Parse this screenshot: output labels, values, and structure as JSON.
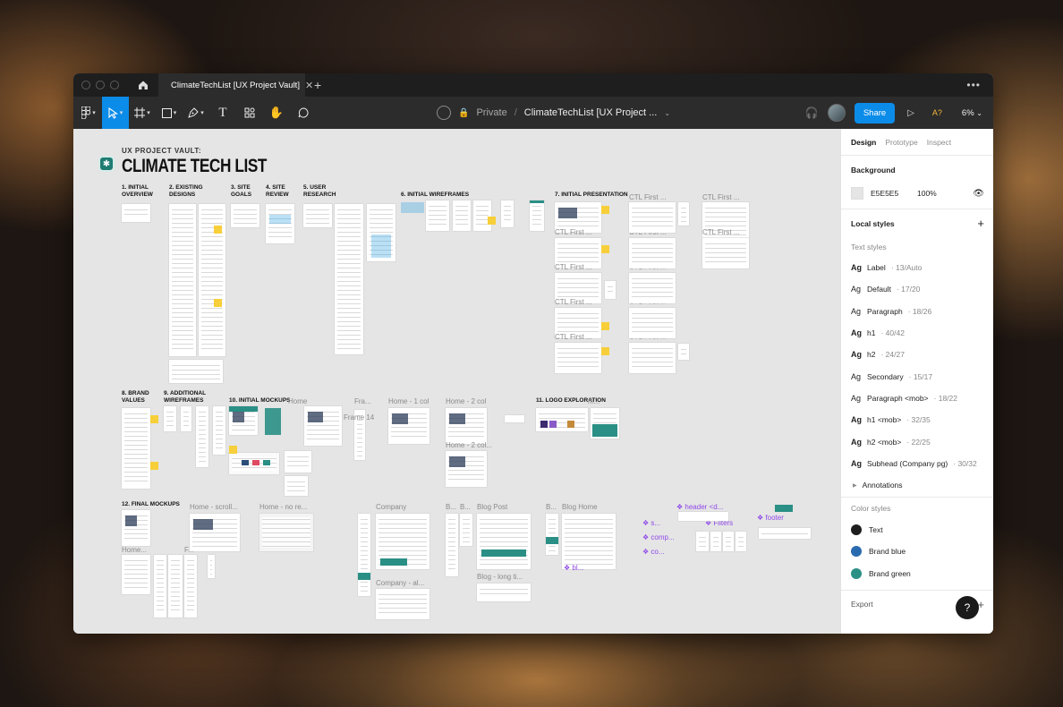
{
  "tab": {
    "title": "ClimateTechList [UX Project Vault]"
  },
  "toolbar": {
    "visibility": "Private",
    "slash": "/",
    "file_name": "ClimateTechList [UX Project ...",
    "share_label": "Share",
    "a11y_label": "A?",
    "zoom": "6%"
  },
  "canvas": {
    "kicker": "UX PROJECT VAULT:",
    "title": "CLIMATE TECH LIST",
    "sections": [
      "1. INITIAL\nOVERVIEW",
      "2. EXISTING\nDESIGNS",
      "3. SITE\nGOALS",
      "4. SITE\nREVIEW",
      "5. USER\nRESEARCH",
      "6. INITIAL WIREFRAMES",
      "7. INITIAL PRESENTATION",
      "8. BRAND\nVALUES",
      "9. ADDITIONAL\nWIREFRAMES",
      "10. INITIAL MOCKUPS",
      "11. LOGO EXPLORATION",
      "12. FINAL MOCKUPS"
    ],
    "frame_labels": {
      "ctl": "CTL First ...",
      "home": "Home",
      "fra": "Fra...",
      "frame14": "Frame 14",
      "home_1col": "Home - 1 col",
      "home_2col": "Home - 2 col",
      "home_2col_short": "Home - 2 col...",
      "home_scroll": "Home - scroll...",
      "home_nore": "Home - no re...",
      "company": "Company",
      "company_al": "Company - al...",
      "blog_post": "Blog Post",
      "blog_long": "Blog - long ti...",
      "blog_home": "Blog Home",
      "b_short": "B...",
      "home_short": "Home...",
      "f_short": "F...",
      "m_short": "m..."
    },
    "components": {
      "header": "header <d...",
      "filters": "Filters",
      "footer": "footer",
      "s": "s...",
      "comp": "comp...",
      "co": "co...",
      "bl": "bl..."
    }
  },
  "panel": {
    "tabs": [
      "Design",
      "Prototype",
      "Inspect"
    ],
    "background_title": "Background",
    "background_hex": "E5E5E5",
    "background_opacity": "100%",
    "local_styles_title": "Local styles",
    "text_styles_title": "Text styles",
    "text_styles": [
      {
        "name": "Label",
        "meta": " · 13/Auto",
        "bold": true
      },
      {
        "name": "Default",
        "meta": " · 17/20",
        "bold": false
      },
      {
        "name": "Paragraph",
        "meta": " · 18/26",
        "bold": false
      },
      {
        "name": "h1",
        "meta": " · 40/42",
        "bold": true
      },
      {
        "name": "h2",
        "meta": " · 24/27",
        "bold": true
      },
      {
        "name": "Secondary",
        "meta": " · 15/17",
        "bold": false
      },
      {
        "name": "Paragraph <mob>",
        "meta": " · 18/22",
        "bold": false
      },
      {
        "name": "h1 <mob>",
        "meta": " · 32/35",
        "bold": true
      },
      {
        "name": "h2 <mob>",
        "meta": " · 22/25",
        "bold": true
      },
      {
        "name": "Subhead (Company pg)",
        "meta": " · 30/32",
        "bold": true
      }
    ],
    "annotations_label": "Annotations",
    "color_styles_title": "Color styles",
    "color_styles": [
      {
        "name": "Text",
        "color": "#1e1e1e"
      },
      {
        "name": "Brand blue",
        "color": "#2a6bb0"
      },
      {
        "name": "Brand green",
        "color": "#2a8f85"
      }
    ],
    "export_title": "Export"
  },
  "help_label": "?"
}
